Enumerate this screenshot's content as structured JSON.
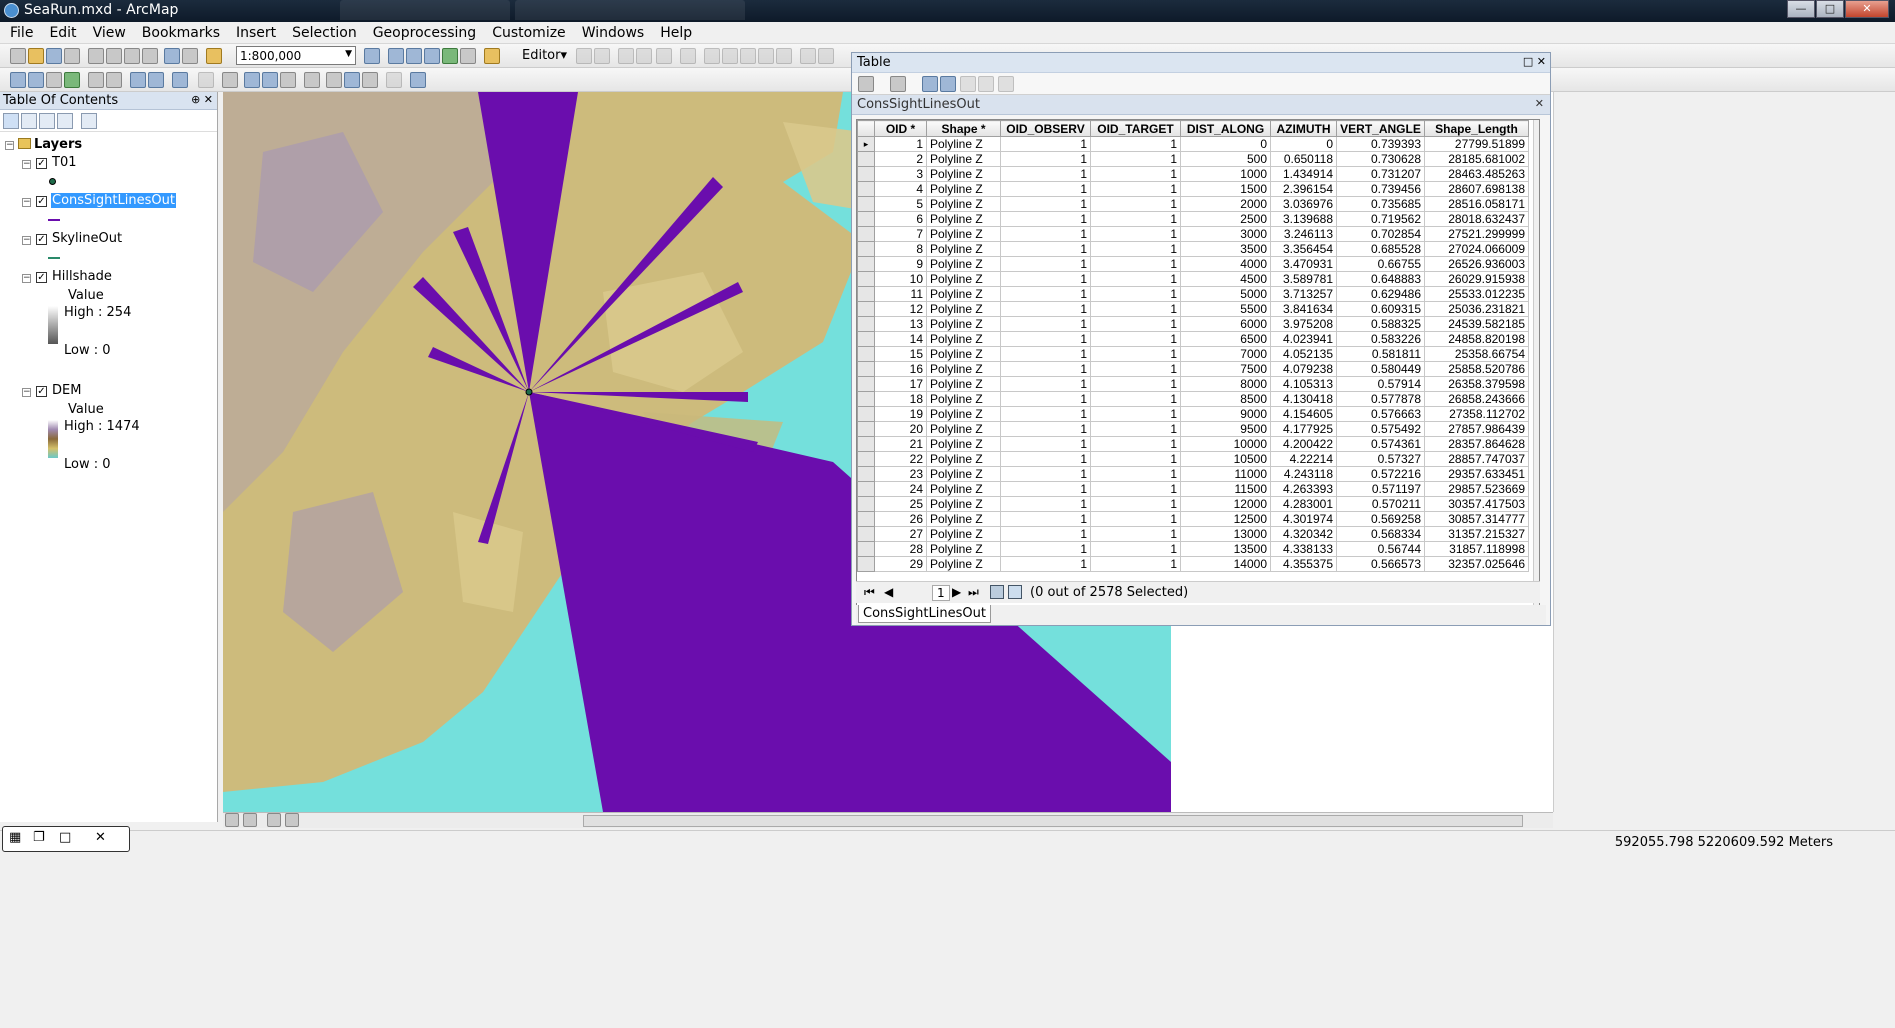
{
  "window": {
    "title": "SeaRun.mxd - ArcMap"
  },
  "menu": [
    "File",
    "Edit",
    "View",
    "Bookmarks",
    "Insert",
    "Selection",
    "Geoprocessing",
    "Customize",
    "Windows",
    "Help"
  ],
  "toolbar": {
    "scale": "1:800,000",
    "editor_label": "Editor▾"
  },
  "toc": {
    "title": "Table Of Contents",
    "group": "Layers",
    "layers": [
      {
        "name": "T01"
      },
      {
        "name": "ConsSightLinesOut"
      },
      {
        "name": "SkylineOut"
      },
      {
        "name": "Hillshade",
        "value_label": "Value",
        "high": "High : 254",
        "low": "Low : 0"
      },
      {
        "name": "DEM",
        "value_label": "Value",
        "high": "High : 1474",
        "low": "Low : 0"
      }
    ]
  },
  "colors": {
    "water": "#74e0dc",
    "sightlines": "#6a0dad",
    "land_low": "#d4c38a",
    "land_high": "#9a8fa6"
  },
  "table": {
    "window_title": "Table",
    "layer_name": "ConsSightLinesOut",
    "columns": [
      "OID *",
      "Shape *",
      "OID_OBSERV",
      "OID_TARGET",
      "DIST_ALONG",
      "AZIMUTH",
      "VERT_ANGLE",
      "Shape_Length"
    ],
    "rows": [
      [
        "1",
        "Polyline Z",
        "1",
        "1",
        "0",
        "0",
        "0.739393",
        "27799.51899"
      ],
      [
        "2",
        "Polyline Z",
        "1",
        "1",
        "500",
        "0.650118",
        "0.730628",
        "28185.681002"
      ],
      [
        "3",
        "Polyline Z",
        "1",
        "1",
        "1000",
        "1.434914",
        "0.731207",
        "28463.485263"
      ],
      [
        "4",
        "Polyline Z",
        "1",
        "1",
        "1500",
        "2.396154",
        "0.739456",
        "28607.698138"
      ],
      [
        "5",
        "Polyline Z",
        "1",
        "1",
        "2000",
        "3.036976",
        "0.735685",
        "28516.058171"
      ],
      [
        "6",
        "Polyline Z",
        "1",
        "1",
        "2500",
        "3.139688",
        "0.719562",
        "28018.632437"
      ],
      [
        "7",
        "Polyline Z",
        "1",
        "1",
        "3000",
        "3.246113",
        "0.702854",
        "27521.299999"
      ],
      [
        "8",
        "Polyline Z",
        "1",
        "1",
        "3500",
        "3.356454",
        "0.685528",
        "27024.066009"
      ],
      [
        "9",
        "Polyline Z",
        "1",
        "1",
        "4000",
        "3.470931",
        "0.66755",
        "26526.936003"
      ],
      [
        "10",
        "Polyline Z",
        "1",
        "1",
        "4500",
        "3.589781",
        "0.648883",
        "26029.915938"
      ],
      [
        "11",
        "Polyline Z",
        "1",
        "1",
        "5000",
        "3.713257",
        "0.629486",
        "25533.012235"
      ],
      [
        "12",
        "Polyline Z",
        "1",
        "1",
        "5500",
        "3.841634",
        "0.609315",
        "25036.231821"
      ],
      [
        "13",
        "Polyline Z",
        "1",
        "1",
        "6000",
        "3.975208",
        "0.588325",
        "24539.582185"
      ],
      [
        "14",
        "Polyline Z",
        "1",
        "1",
        "6500",
        "4.023941",
        "0.583226",
        "24858.820198"
      ],
      [
        "15",
        "Polyline Z",
        "1",
        "1",
        "7000",
        "4.052135",
        "0.581811",
        "25358.66754"
      ],
      [
        "16",
        "Polyline Z",
        "1",
        "1",
        "7500",
        "4.079238",
        "0.580449",
        "25858.520786"
      ],
      [
        "17",
        "Polyline Z",
        "1",
        "1",
        "8000",
        "4.105313",
        "0.57914",
        "26358.379598"
      ],
      [
        "18",
        "Polyline Z",
        "1",
        "1",
        "8500",
        "4.130418",
        "0.577878",
        "26858.243666"
      ],
      [
        "19",
        "Polyline Z",
        "1",
        "1",
        "9000",
        "4.154605",
        "0.576663",
        "27358.112702"
      ],
      [
        "20",
        "Polyline Z",
        "1",
        "1",
        "9500",
        "4.177925",
        "0.575492",
        "27857.986439"
      ],
      [
        "21",
        "Polyline Z",
        "1",
        "1",
        "10000",
        "4.200422",
        "0.574361",
        "28357.864628"
      ],
      [
        "22",
        "Polyline Z",
        "1",
        "1",
        "10500",
        "4.22214",
        "0.57327",
        "28857.747037"
      ],
      [
        "23",
        "Polyline Z",
        "1",
        "1",
        "11000",
        "4.243118",
        "0.572216",
        "29357.633451"
      ],
      [
        "24",
        "Polyline Z",
        "1",
        "1",
        "11500",
        "4.263393",
        "0.571197",
        "29857.523669"
      ],
      [
        "25",
        "Polyline Z",
        "1",
        "1",
        "12000",
        "4.283001",
        "0.570211",
        "30357.417503"
      ],
      [
        "26",
        "Polyline Z",
        "1",
        "1",
        "12500",
        "4.301974",
        "0.569258",
        "30857.314777"
      ],
      [
        "27",
        "Polyline Z",
        "1",
        "1",
        "13000",
        "4.320342",
        "0.568334",
        "31357.215327"
      ],
      [
        "28",
        "Polyline Z",
        "1",
        "1",
        "13500",
        "4.338133",
        "0.56744",
        "31857.118998"
      ],
      [
        "29",
        "Polyline Z",
        "1",
        "1",
        "14000",
        "4.355375",
        "0.566573",
        "32357.025646"
      ]
    ],
    "current_record": "1",
    "selection_status": "(0 out of 2578 Selected)",
    "tab_label": "ConsSightLinesOut"
  },
  "status": {
    "coordinates": "592055.798  5220609.592 Meters"
  }
}
